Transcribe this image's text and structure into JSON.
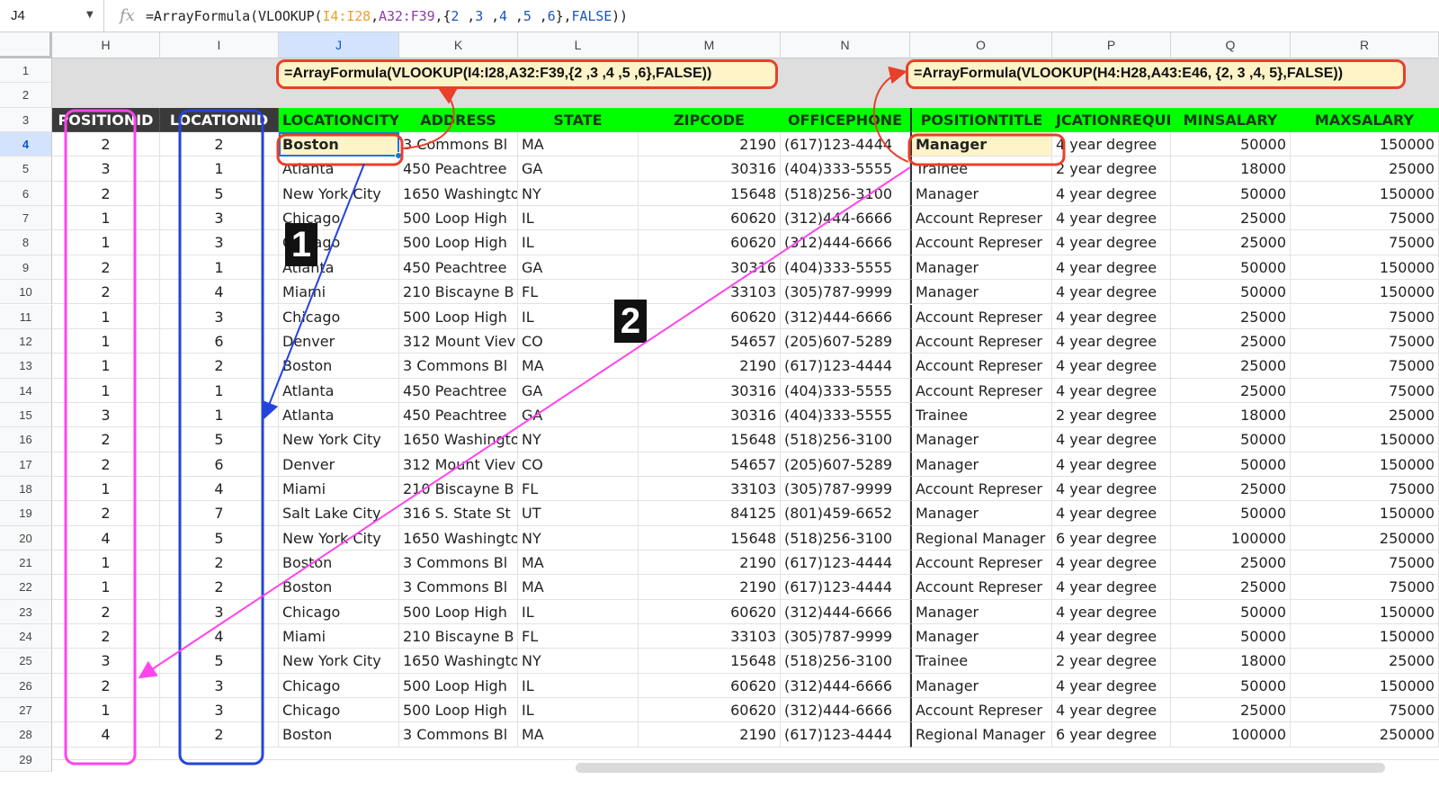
{
  "formula_bar": {
    "cell_ref": "J4",
    "fx": "fx",
    "formula_parts": [
      {
        "t": "=ArrayFormula(VLOOKUP(",
        "c": "plain"
      },
      {
        "t": "I4:I28",
        "c": "r1"
      },
      {
        "t": ",",
        "c": "plain"
      },
      {
        "t": "A32:F39",
        "c": "r2"
      },
      {
        "t": ",{",
        "c": "plain"
      },
      {
        "t": "2",
        "c": "c"
      },
      {
        "t": " ,",
        "c": "plain"
      },
      {
        "t": "3",
        "c": "c"
      },
      {
        "t": " ,",
        "c": "plain"
      },
      {
        "t": "4",
        "c": "c"
      },
      {
        "t": " ,",
        "c": "plain"
      },
      {
        "t": "5",
        "c": "c"
      },
      {
        "t": " ,",
        "c": "plain"
      },
      {
        "t": "6",
        "c": "c"
      },
      {
        "t": "},",
        "c": "plain"
      },
      {
        "t": "FALSE",
        "c": "c"
      },
      {
        "t": "))",
        "c": "plain"
      }
    ]
  },
  "columns": [
    "H",
    "I",
    "J",
    "K",
    "L",
    "M",
    "N",
    "O",
    "P",
    "Q",
    "R"
  ],
  "selected_column": "J",
  "selected_row": "4",
  "row_numbers": [
    "1",
    "2",
    "3",
    "4",
    "5",
    "6",
    "7",
    "8",
    "9",
    "10",
    "11",
    "12",
    "13",
    "14",
    "15",
    "16",
    "17",
    "18",
    "19",
    "20",
    "21",
    "22",
    "23",
    "24",
    "25",
    "26",
    "27",
    "28",
    "29"
  ],
  "headers": [
    "POSITIONID",
    "LOCATIONID",
    "LOCATIONCITY",
    "ADDRESS",
    "STATE",
    "ZIPCODE",
    "OFFICEPHONE",
    "POSITIONTITLE",
    "JCATIONREQUII",
    "MINSALARY",
    "MAXSALARY"
  ],
  "rows": [
    [
      "2",
      "2",
      "Boston",
      "3 Commons Bl",
      "MA",
      "2190",
      "(617)123-4444",
      "Manager",
      "4 year degree",
      "50000",
      "150000"
    ],
    [
      "3",
      "1",
      "Atlanta",
      "450 Peachtree",
      "GA",
      "30316",
      "(404)333-5555",
      "Trainee",
      "2 year degree",
      "18000",
      "25000"
    ],
    [
      "2",
      "5",
      "New York City",
      "1650 Washingto",
      "NY",
      "15648",
      "(518)256-3100",
      "Manager",
      "4 year degree",
      "50000",
      "150000"
    ],
    [
      "1",
      "3",
      "Chicago",
      "500 Loop High",
      "IL",
      "60620",
      "(312)444-6666",
      "Account Represer",
      "4 year degree",
      "25000",
      "75000"
    ],
    [
      "1",
      "3",
      "Chicago",
      "500 Loop High",
      "IL",
      "60620",
      "(312)444-6666",
      "Account Represer",
      "4 year degree",
      "25000",
      "75000"
    ],
    [
      "2",
      "1",
      "Atlanta",
      "450 Peachtree",
      "GA",
      "30316",
      "(404)333-5555",
      "Manager",
      "4 year degree",
      "50000",
      "150000"
    ],
    [
      "2",
      "4",
      "Miami",
      "210 Biscayne B",
      "FL",
      "33103",
      "(305)787-9999",
      "Manager",
      "4 year degree",
      "50000",
      "150000"
    ],
    [
      "1",
      "3",
      "Chicago",
      "500 Loop High",
      "IL",
      "60620",
      "(312)444-6666",
      "Account Represer",
      "4 year degree",
      "25000",
      "75000"
    ],
    [
      "1",
      "6",
      "Denver",
      "312 Mount Viev",
      "CO",
      "54657",
      "(205)607-5289",
      "Account Represer",
      "4 year degree",
      "25000",
      "75000"
    ],
    [
      "1",
      "2",
      "Boston",
      "3 Commons Bl",
      "MA",
      "2190",
      "(617)123-4444",
      "Account Represer",
      "4 year degree",
      "25000",
      "75000"
    ],
    [
      "1",
      "1",
      "Atlanta",
      "450 Peachtree",
      "GA",
      "30316",
      "(404)333-5555",
      "Account Represer",
      "4 year degree",
      "25000",
      "75000"
    ],
    [
      "3",
      "1",
      "Atlanta",
      "450 Peachtree",
      "GA",
      "30316",
      "(404)333-5555",
      "Trainee",
      "2 year degree",
      "18000",
      "25000"
    ],
    [
      "2",
      "5",
      "New York City",
      "1650 Washingto",
      "NY",
      "15648",
      "(518)256-3100",
      "Manager",
      "4 year degree",
      "50000",
      "150000"
    ],
    [
      "2",
      "6",
      "Denver",
      "312 Mount Viev",
      "CO",
      "54657",
      "(205)607-5289",
      "Manager",
      "4 year degree",
      "50000",
      "150000"
    ],
    [
      "1",
      "4",
      "Miami",
      "210 Biscayne B",
      "FL",
      "33103",
      "(305)787-9999",
      "Account Represer",
      "4 year degree",
      "25000",
      "75000"
    ],
    [
      "2",
      "7",
      "Salt Lake City",
      "316 S. State St",
      "UT",
      "84125",
      "(801)459-6652",
      "Manager",
      "4 year degree",
      "50000",
      "150000"
    ],
    [
      "4",
      "5",
      "New York City",
      "1650 Washingto",
      "NY",
      "15648",
      "(518)256-3100",
      "Regional Manager",
      "6 year degree",
      "100000",
      "250000"
    ],
    [
      "1",
      "2",
      "Boston",
      "3 Commons Bl",
      "MA",
      "2190",
      "(617)123-4444",
      "Account Represer",
      "4 year degree",
      "25000",
      "75000"
    ],
    [
      "1",
      "2",
      "Boston",
      "3 Commons Bl",
      "MA",
      "2190",
      "(617)123-4444",
      "Account Represer",
      "4 year degree",
      "25000",
      "75000"
    ],
    [
      "2",
      "3",
      "Chicago",
      "500 Loop High",
      "IL",
      "60620",
      "(312)444-6666",
      "Manager",
      "4 year degree",
      "50000",
      "150000"
    ],
    [
      "2",
      "4",
      "Miami",
      "210 Biscayne B",
      "FL",
      "33103",
      "(305)787-9999",
      "Manager",
      "4 year degree",
      "50000",
      "150000"
    ],
    [
      "3",
      "5",
      "New York City",
      "1650 Washingto",
      "NY",
      "15648",
      "(518)256-3100",
      "Trainee",
      "2 year degree",
      "18000",
      "25000"
    ],
    [
      "2",
      "3",
      "Chicago",
      "500 Loop High",
      "IL",
      "60620",
      "(312)444-6666",
      "Manager",
      "4 year degree",
      "50000",
      "150000"
    ],
    [
      "1",
      "3",
      "Chicago",
      "500 Loop High",
      "IL",
      "60620",
      "(312)444-6666",
      "Account Represer",
      "4 year degree",
      "25000",
      "75000"
    ],
    [
      "4",
      "2",
      "Boston",
      "3 Commons Bl",
      "MA",
      "2190",
      "(617)123-4444",
      "Regional Manager",
      "6 year degree",
      "100000",
      "250000"
    ]
  ],
  "annotations": {
    "formula_callout_1": "=ArrayFormula(VLOOKUP(I4:I28,A32:F39,{2 ,3 ,4 ,5 ,6},FALSE))",
    "formula_callout_2": "=ArrayFormula(VLOOKUP(H4:H28,A43:E46, {2, 3 ,4, 5},FALSE))",
    "badge_1": "1",
    "badge_2": "2",
    "highlight_j4": "Boston",
    "highlight_o4": "Manager"
  },
  "colors": {
    "header_dark": "#3a3a3a",
    "header_green": "#00ff00",
    "callout_red": "#e8402a",
    "bracket_pink": "#ff44ee",
    "bracket_blue": "#2244dd",
    "select_blue": "#d3e3fd"
  }
}
